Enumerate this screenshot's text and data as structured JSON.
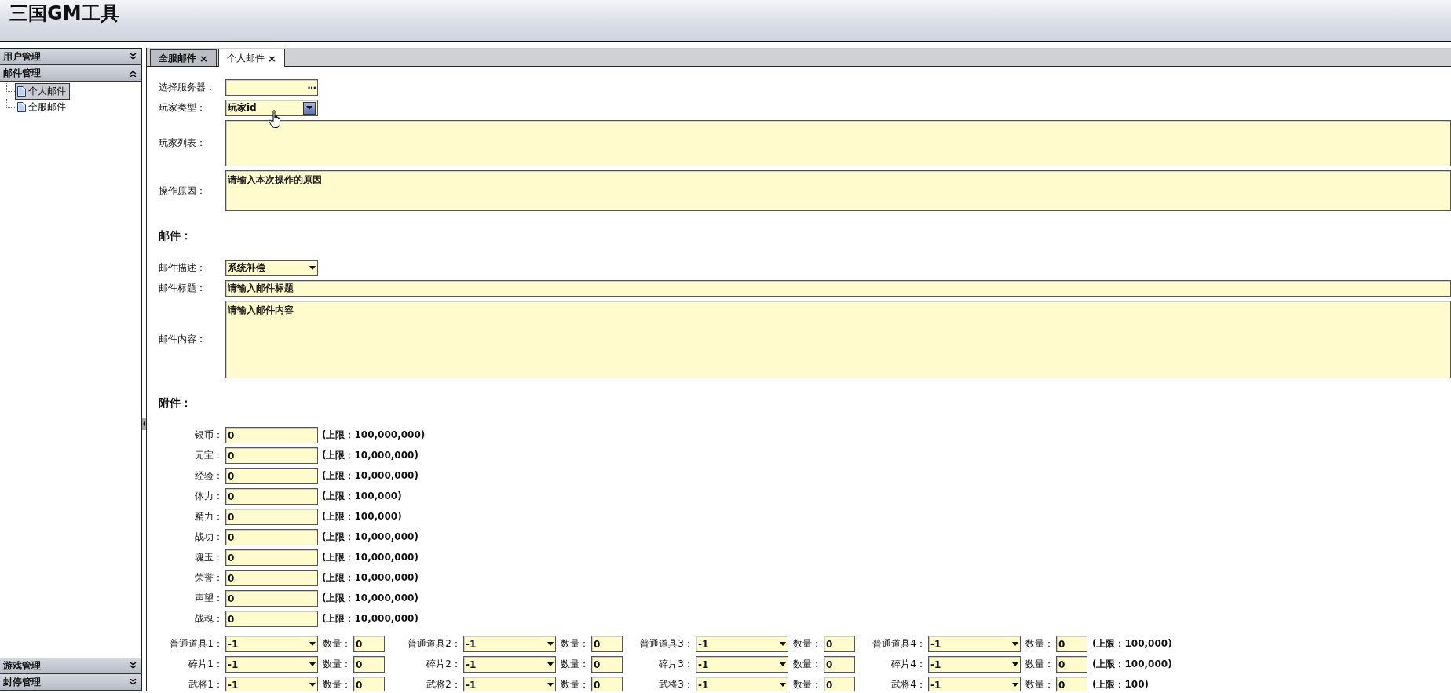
{
  "app_title": "三国GM工具",
  "sidebar": {
    "sections": [
      {
        "label": "用户管理",
        "expanded": false
      },
      {
        "label": "邮件管理",
        "expanded": true,
        "children": [
          {
            "label": "个人邮件",
            "selected": true
          },
          {
            "label": "全服邮件",
            "selected": false
          }
        ]
      }
    ],
    "bottom_sections": [
      {
        "label": "游戏管理",
        "expanded": false
      },
      {
        "label": "封停管理",
        "expanded": false
      }
    ]
  },
  "tabs": [
    {
      "label": "全服邮件",
      "close": "×",
      "selected": false
    },
    {
      "label": "个人邮件",
      "close": "×",
      "selected": true
    }
  ],
  "form": {
    "fields": [
      {
        "label": "选择服务器：",
        "kind": "picker",
        "button_text": "···"
      },
      {
        "label": "玩家类型：",
        "kind": "combo",
        "value": "玩家id"
      },
      {
        "label": "玩家列表：",
        "kind": "textarea"
      },
      {
        "label": "操作原因：",
        "kind": "textarea",
        "placeholder": "请输入本次操作的原因"
      }
    ],
    "mail": {
      "heading": "邮件：",
      "fields": [
        {
          "label": "邮件描述：",
          "kind": "select",
          "value": "系统补偿"
        },
        {
          "label": "邮件标题：",
          "kind": "text",
          "placeholder": "请输入邮件标题"
        },
        {
          "label": "邮件内容：",
          "kind": "textarea",
          "placeholder": "请输入邮件内容"
        }
      ]
    },
    "attachments": {
      "heading": "附件：",
      "resources": [
        {
          "label": "银币：",
          "value": "0",
          "limit": "(上限：100,000,000)"
        },
        {
          "label": "元宝：",
          "value": "0",
          "limit": "(上限：10,000,000)"
        },
        {
          "label": "经验：",
          "value": "0",
          "limit": "(上限：10,000,000)"
        },
        {
          "label": "体力：",
          "value": "0",
          "limit": "(上限：100,000)"
        },
        {
          "label": "精力：",
          "value": "0",
          "limit": "(上限：100,000)"
        },
        {
          "label": "战功：",
          "value": "0",
          "limit": "(上限：10,000,000)"
        },
        {
          "label": "魂玉：",
          "value": "0",
          "limit": "(上限：10,000,000)"
        },
        {
          "label": "荣誉：",
          "value": "0",
          "limit": "(上限：10,000,000)"
        },
        {
          "label": "声望：",
          "value": "0",
          "limit": "(上限：10,000,000)"
        },
        {
          "label": "战魂：",
          "value": "0",
          "limit": "(上限：10,000,000)"
        }
      ],
      "item_rows": [
        {
          "slots": [
            {
              "label": "普通道具1：",
              "value": "-1",
              "qty_label": "数量：",
              "qty": "0"
            },
            {
              "label": "普通道具2：",
              "value": "-1",
              "qty_label": "数量：",
              "qty": "0"
            },
            {
              "label": "普通道具3：",
              "value": "-1",
              "qty_label": "数量：",
              "qty": "0"
            },
            {
              "label": "普通道具4：",
              "value": "-1",
              "qty_label": "数量：",
              "qty": "0"
            }
          ],
          "limit": "(上限：100,000)"
        },
        {
          "slots": [
            {
              "label": "碎片1：",
              "value": "-1",
              "qty_label": "数量：",
              "qty": "0"
            },
            {
              "label": "碎片2：",
              "value": "-1",
              "qty_label": "数量：",
              "qty": "0"
            },
            {
              "label": "碎片3：",
              "value": "-1",
              "qty_label": "数量：",
              "qty": "0"
            },
            {
              "label": "碎片4：",
              "value": "-1",
              "qty_label": "数量：",
              "qty": "0"
            }
          ],
          "limit": "(上限：100,000)"
        },
        {
          "slots": [
            {
              "label": "武将1：",
              "value": "-1",
              "qty_label": "数量：",
              "qty": "0"
            },
            {
              "label": "武将2：",
              "value": "-1",
              "qty_label": "数量：",
              "qty": "0"
            },
            {
              "label": "武将3：",
              "value": "-1",
              "qty_label": "数量：",
              "qty": "0"
            },
            {
              "label": "武将4：",
              "value": "-1",
              "qty_label": "数量：",
              "qty": "0"
            }
          ],
          "limit": "(上限：100)"
        }
      ]
    }
  }
}
